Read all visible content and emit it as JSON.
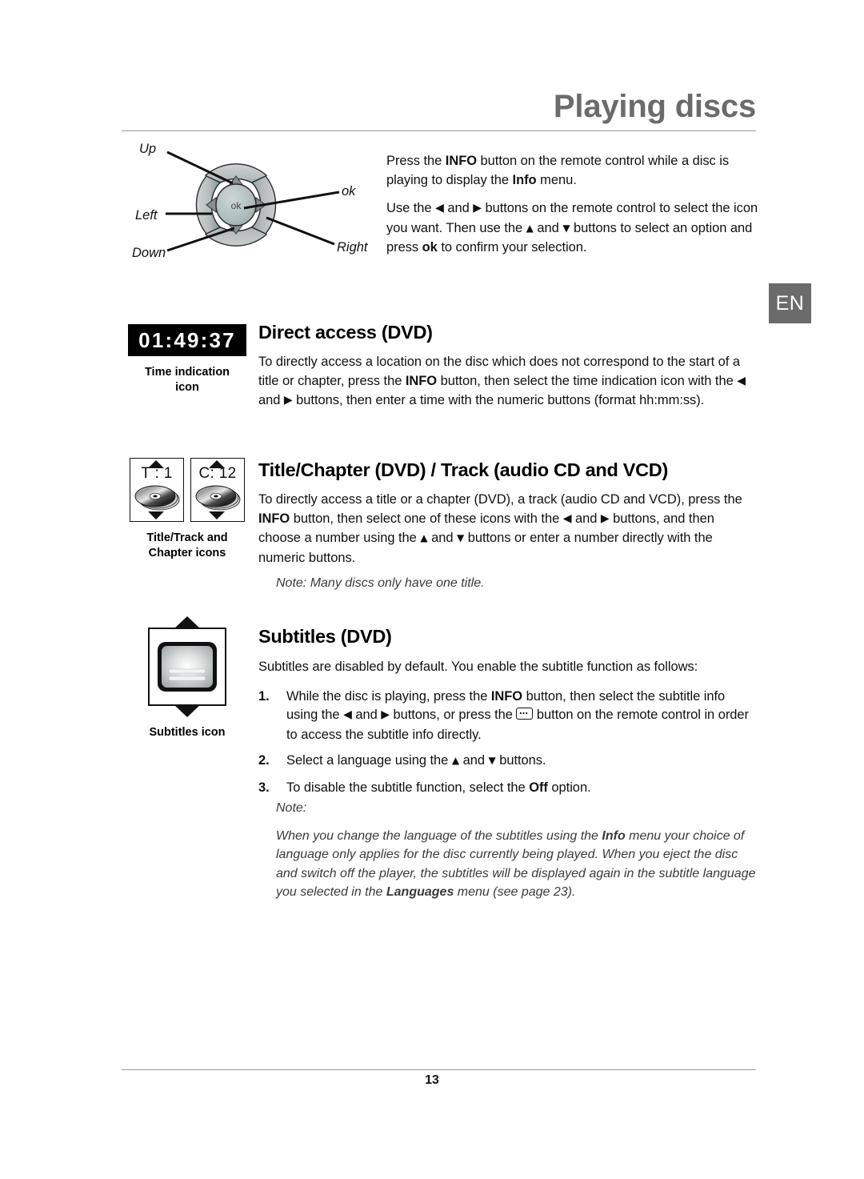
{
  "header": {
    "title": "Playing discs",
    "language_tab": "EN"
  },
  "footer": {
    "page_number": "13"
  },
  "navpad": {
    "labels": {
      "up": "Up",
      "left": "Left",
      "down": "Down",
      "ok": "ok",
      "right": "Right"
    },
    "center_button_text": "ok"
  },
  "intro": {
    "para1_pre": "Press the ",
    "para1_b1": "INFO",
    "para1_mid": " button on the remote control while a disc is playing to display the ",
    "para1_b2": "Info",
    "para1_post": " menu.",
    "para2_pre": "Use the ",
    "para2_a": " and ",
    "para2_mid": " buttons on the remote control to select the icon you want. Then use the ",
    "para2_b": " and ",
    "para2_mid2": " buttons to select an option and press ",
    "para2_bold": "ok",
    "para2_post": " to confirm your selection."
  },
  "sections": [
    {
      "id": "direct-access",
      "heading": "Direct access (DVD)",
      "icon_caption_line1": "Time indication",
      "icon_caption_line2": "icon",
      "time_value": "01:49:37",
      "body_pre": "To directly access a location on the disc which does not correspond to the start of a title or chapter, press the ",
      "body_b1": "INFO",
      "body_mid": " button, then select the time indication icon with the ",
      "body_and1": " and ",
      "body_post": " buttons, then enter a time with the numeric buttons (format hh:mm:ss)."
    },
    {
      "id": "title-chapter-track",
      "heading": "Title/Chapter (DVD) / Track (audio CD and VCD)",
      "icon_caption_line1": "Title/Track and",
      "icon_caption_line2": "Chapter icons",
      "disc_icons": [
        {
          "label": "T : 1",
          "name": "title-track-icon"
        },
        {
          "label": "C: 12",
          "name": "chapter-icon"
        }
      ],
      "body_pre": "To directly access a title or a chapter (DVD), a track (audio CD and VCD), press the ",
      "body_b1": "INFO",
      "body_mid": " button, then select one of these icons with the ",
      "body_and1": " and ",
      "body_mid2": " buttons, and then choose a number using the ",
      "body_and2": " and ",
      "body_post": " buttons or enter a number directly with the numeric buttons.",
      "note": "Note: Many discs only have one title."
    },
    {
      "id": "subtitles",
      "heading": "Subtitles (DVD)",
      "icon_caption_line1": "Subtitles icon",
      "intro": "Subtitles are disabled by default. You enable the subtitle function as follows:",
      "steps": [
        {
          "num": "1.",
          "pre": "While the disc is playing, press the ",
          "b1": "INFO",
          "mid": " button, then select the subtitle info using the ",
          "and1": " and ",
          "mid2": " buttons, or press the ",
          "post": " button on the remote control in order to access the subtitle info directly."
        },
        {
          "num": "2.",
          "pre": "Select a language using the ",
          "and1": " and ",
          "post": " buttons."
        },
        {
          "num": "3.",
          "pre": "To disable the subtitle function, select the ",
          "b1": "Off",
          "post": " option."
        }
      ],
      "note_label": "Note:",
      "note_pre": "When you change the language of the subtitles using the ",
      "note_b1": "Info",
      "note_mid": " menu your choice of language only applies for the disc currently being played. When you eject the disc and switch off the player, the subtitles will be displayed again in the subtitle language you selected in the ",
      "note_b2": "Languages",
      "note_post": " menu (see page 23)."
    }
  ],
  "colors": {
    "header_gray": "#6b6b6b",
    "rule_gray": "#9a9a9a",
    "icon_black": "#000000",
    "pad_gray": "#b9bdbd",
    "pad_teal": "#8fa3a6"
  }
}
